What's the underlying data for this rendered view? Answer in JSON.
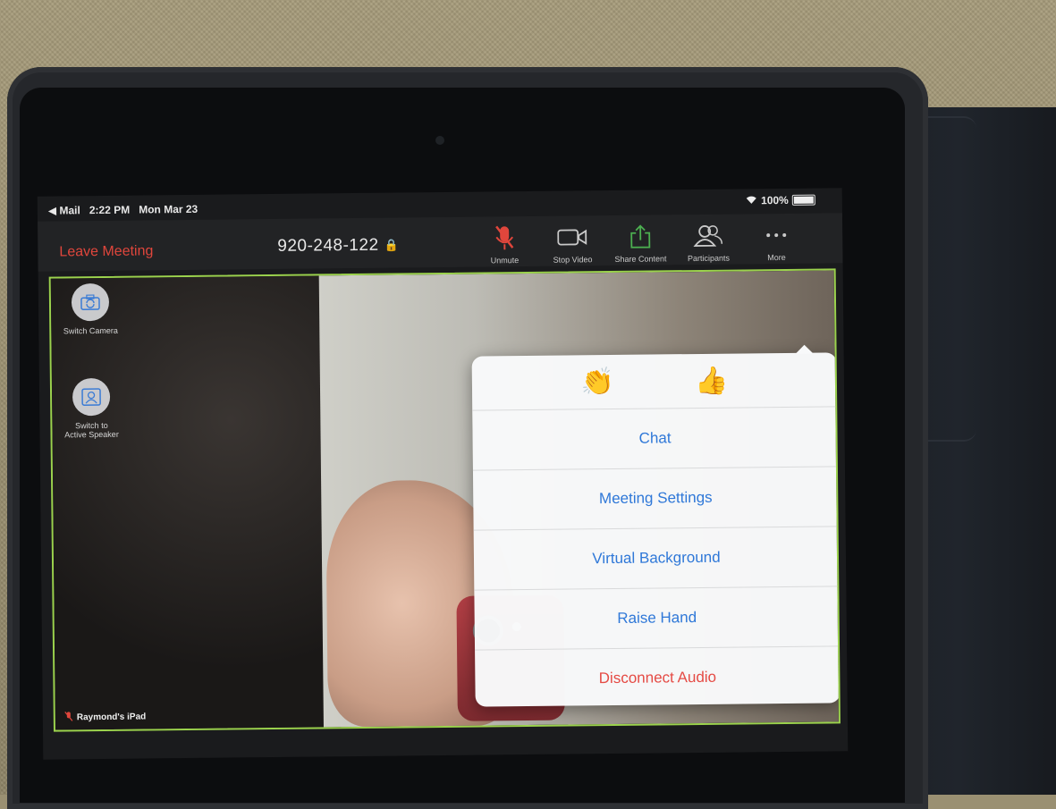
{
  "status_bar": {
    "back_app": "◀ Mail",
    "time": "2:22 PM",
    "date": "Mon Mar 23",
    "battery": "100%"
  },
  "toolbar": {
    "leave_label": "Leave Meeting",
    "meeting_id": "920-248-122",
    "buttons": [
      {
        "label": "Unmute",
        "icon": "muted-mic-icon",
        "color": "#e0463c"
      },
      {
        "label": "Stop Video",
        "icon": "video-camera-icon",
        "color": "#c9c9c9"
      },
      {
        "label": "Share Content",
        "icon": "share-upload-icon",
        "color": "#4caf50"
      },
      {
        "label": "Participants",
        "icon": "participants-icon",
        "color": "#c9c9c9"
      },
      {
        "label": "More",
        "icon": "more-dots-icon",
        "color": "#c9c9c9"
      }
    ]
  },
  "side_controls": {
    "switch_camera": "Switch Camera",
    "switch_speaker_line1": "Switch to",
    "switch_speaker_line2": "Active Speaker"
  },
  "participant_name": "Raymond's iPad",
  "more_menu": {
    "reactions": [
      "👏",
      "👍"
    ],
    "items": [
      {
        "label": "Chat"
      },
      {
        "label": "Meeting Settings"
      },
      {
        "label": "Virtual Background"
      },
      {
        "label": "Raise Hand"
      },
      {
        "label": "Disconnect Audio",
        "danger": true
      }
    ]
  },
  "colors": {
    "accent_blue": "#2f78d8",
    "danger_red": "#e54b45",
    "active_border": "#9bd24d"
  }
}
